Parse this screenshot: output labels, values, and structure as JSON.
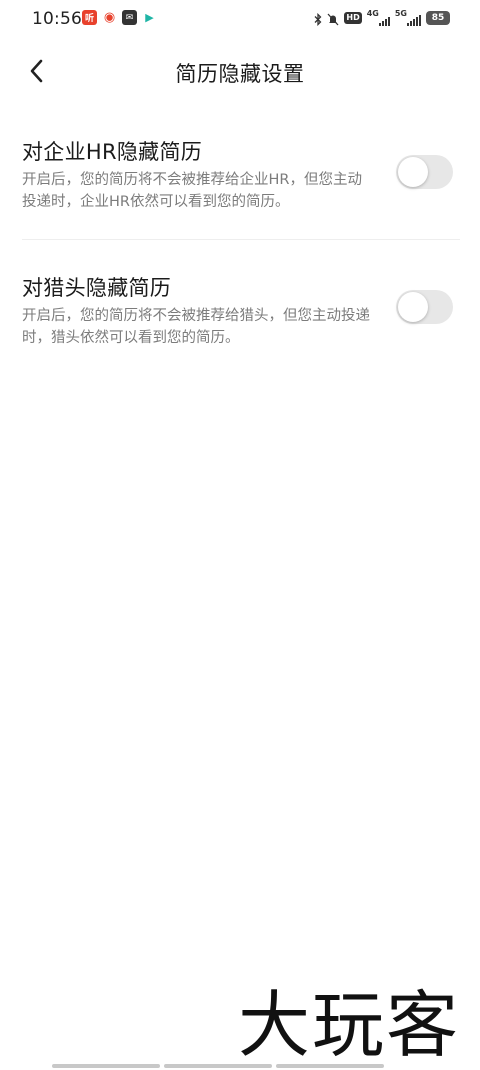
{
  "status_bar": {
    "time": "10:56",
    "app_icons": [
      {
        "name": "listen-app-icon",
        "glyph": "听",
        "color": "#e8412c"
      },
      {
        "name": "weibo-icon",
        "glyph": "◉",
        "color": "#e8412c"
      },
      {
        "name": "mail-app-icon",
        "glyph": "✉",
        "color": "#333333"
      },
      {
        "name": "play-store-icon",
        "glyph": "▶",
        "color": "#1fb5a6"
      }
    ],
    "hd_label": "HD",
    "sim_label": "4G",
    "sim2_label": "5G",
    "battery": "85"
  },
  "header": {
    "title": "简历隐藏设置",
    "back_icon": "chevron-left-icon"
  },
  "settings": [
    {
      "title": "对企业HR隐藏简历",
      "description": "开启后，您的简历将不会被推荐给企业HR，但您主动投递时，企业HR依然可以看到您的简历。",
      "enabled": false
    },
    {
      "title": "对猎头隐藏简历",
      "description": "开启后，您的简历将不会被推荐给猎头，但您主动投递时，猎头依然可以看到您的简历。",
      "enabled": false
    }
  ],
  "watermark": "大玩客",
  "colors": {
    "toggle_off": "#e7e7e7",
    "desc_text": "#7c7c7c",
    "title_text": "#1b1b1b"
  }
}
